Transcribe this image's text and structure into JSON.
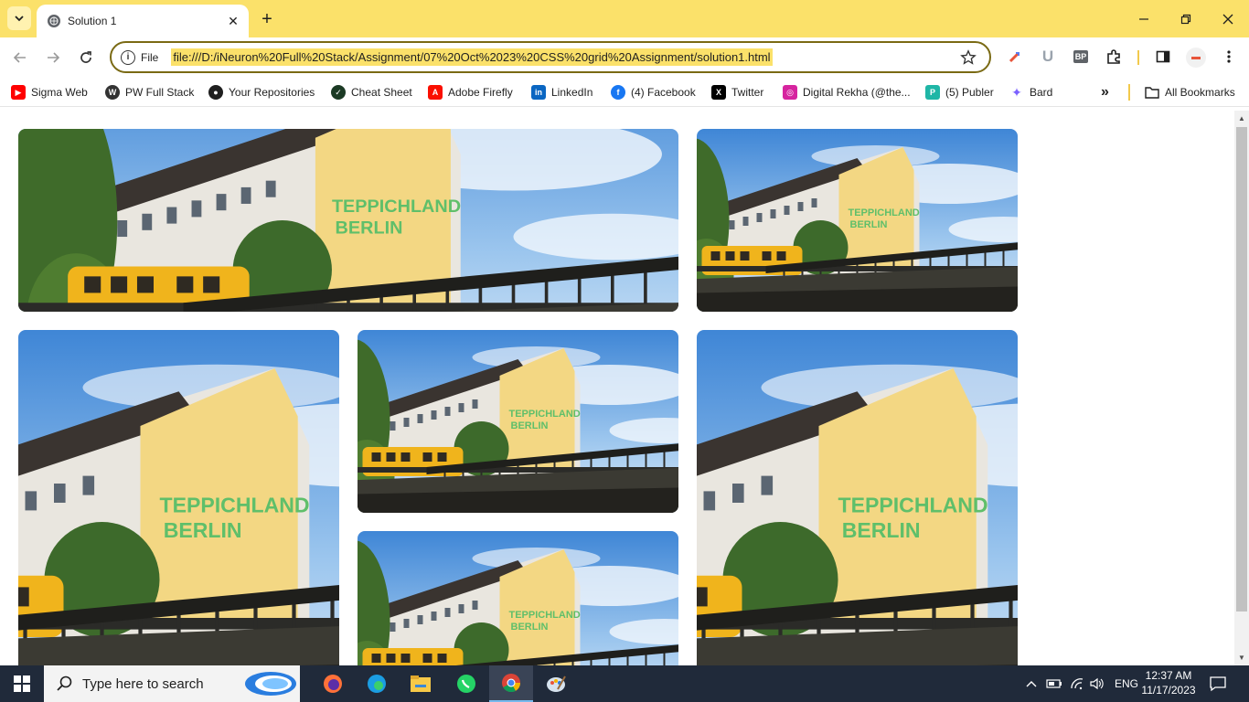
{
  "browser": {
    "tab_title": "Solution 1",
    "scheme_label": "File",
    "url": "file:///D:/iNeuron%20Full%20Stack/Assignment/07%20Oct%2023%20CSS%20grid%20Assignment/solution1.html"
  },
  "bookmarks": {
    "items": [
      {
        "label": "Sigma Web",
        "icon": "youtube-icon",
        "color": "#ff0000"
      },
      {
        "label": "PW Full Stack",
        "icon": "pw-icon",
        "color": "#333333"
      },
      {
        "label": "Your Repositories",
        "icon": "github-icon",
        "color": "#1f1f1f"
      },
      {
        "label": "Cheat Sheet",
        "icon": "cheatsheet-icon",
        "color": "#1b3a24"
      },
      {
        "label": "Adobe Firefly",
        "icon": "adobe-icon",
        "color": "#fa0f00"
      },
      {
        "label": "LinkedIn",
        "icon": "linkedin-icon",
        "color": "#0a66c2"
      },
      {
        "label": "(4) Facebook",
        "icon": "facebook-icon",
        "color": "#1877f2"
      },
      {
        "label": "Twitter",
        "icon": "x-icon",
        "color": "#000000"
      },
      {
        "label": "Digital Rekha (@the...",
        "icon": "instagram-icon",
        "color": "#d6249f"
      },
      {
        "label": "(5) Publer",
        "icon": "publer-icon",
        "color": "#1fb6a6"
      },
      {
        "label": "Bard",
        "icon": "bard-icon",
        "color": "#7b61ff"
      }
    ],
    "overflow_label": "»",
    "all_bookmarks_label": "All Bookmarks"
  },
  "taskbar": {
    "search_placeholder": "Type here to search",
    "language": "ENG",
    "time": "12:37 AM",
    "date": "11/17/2023"
  },
  "colors": {
    "titlebar": "#fbe16a",
    "taskbar": "#202a3a"
  }
}
